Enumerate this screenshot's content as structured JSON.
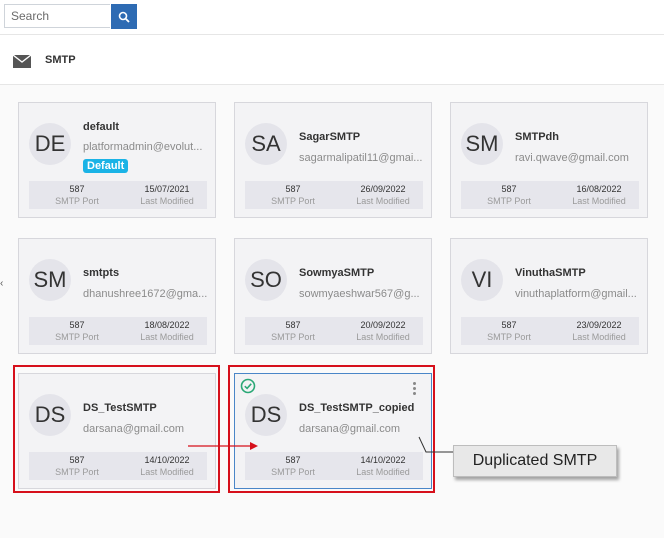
{
  "search": {
    "placeholder": "Search"
  },
  "section": {
    "title": "SMTP"
  },
  "cards": [
    {
      "initials": "DE",
      "name": "default",
      "email": "platformadmin@evolut...",
      "badge": "Default",
      "port": "587",
      "port_label": "SMTP Port",
      "date": "15/07/2021",
      "date_label": "Last Modified"
    },
    {
      "initials": "SA",
      "name": "SagarSMTP",
      "email": "sagarmalipatil11@gmai...",
      "port": "587",
      "port_label": "SMTP Port",
      "date": "26/09/2022",
      "date_label": "Last Modified"
    },
    {
      "initials": "SM",
      "name": "SMTPdh",
      "email": "ravi.qwave@gmail.com",
      "port": "587",
      "port_label": "SMTP Port",
      "date": "16/08/2022",
      "date_label": "Last Modified"
    },
    {
      "initials": "SM",
      "name": "smtpts",
      "email": "dhanushree1672@gma...",
      "port": "587",
      "port_label": "SMTP Port",
      "date": "18/08/2022",
      "date_label": "Last Modified"
    },
    {
      "initials": "SO",
      "name": "SowmyaSMTP",
      "email": "sowmyaeshwar567@g...",
      "port": "587",
      "port_label": "SMTP Port",
      "date": "20/09/2022",
      "date_label": "Last Modified"
    },
    {
      "initials": "VI",
      "name": "VinuthaSMTP",
      "email": "vinuthaplatform@gmail...",
      "port": "587",
      "port_label": "SMTP Port",
      "date": "23/09/2022",
      "date_label": "Last Modified"
    },
    {
      "initials": "DS",
      "name": "DS_TestSMTP",
      "email": "darsana@gmail.com",
      "port": "587",
      "port_label": "SMTP Port",
      "date": "14/10/2022",
      "date_label": "Last Modified"
    },
    {
      "initials": "DS",
      "name": "DS_TestSMTP_copied",
      "email": "darsana@gmail.com",
      "port": "587",
      "port_label": "SMTP Port",
      "date": "14/10/2022",
      "date_label": "Last Modified"
    }
  ],
  "annotation": {
    "label": "Duplicated SMTP"
  },
  "colors": {
    "accent": "#2e6bb3",
    "badge": "#1ab3e6",
    "highlight": "#d6101b",
    "check": "#2aa876"
  }
}
